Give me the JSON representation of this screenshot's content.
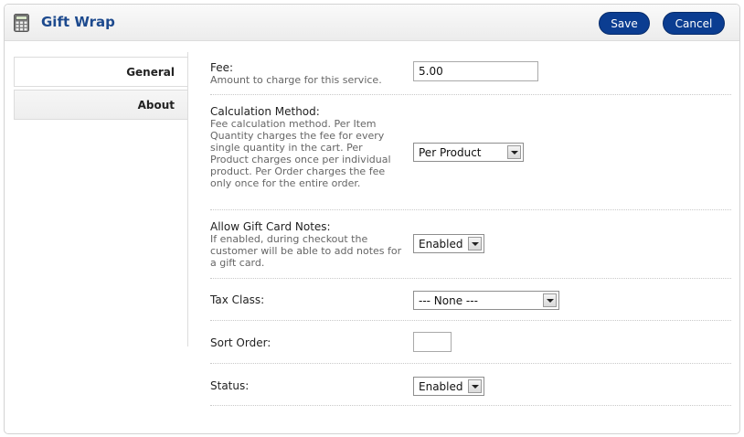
{
  "header": {
    "title": "Gift Wrap",
    "save_label": "Save",
    "cancel_label": "Cancel",
    "icon": "calculator-icon"
  },
  "tabs": [
    {
      "label": "General",
      "active": true
    },
    {
      "label": "About",
      "active": false
    }
  ],
  "fields": {
    "fee": {
      "label": "Fee:",
      "description": "Amount to charge for this service.",
      "value": "5.00"
    },
    "calculation_method": {
      "label": "Calculation Method:",
      "description": "Fee calculation method. Per Item Quantity charges the fee for every single quantity in the cart. Per Product charges once per individual product. Per Order charges the fee only once for the entire order.",
      "selected": "Per Product"
    },
    "gift_card_notes": {
      "label": "Allow Gift Card Notes:",
      "description": "If enabled, during checkout the customer will be able to add notes for a gift card.",
      "selected": "Enabled"
    },
    "tax_class": {
      "label": "Tax Class:",
      "selected": "--- None ---"
    },
    "sort_order": {
      "label": "Sort Order:",
      "value": ""
    },
    "status": {
      "label": "Status:",
      "selected": "Enabled"
    }
  }
}
